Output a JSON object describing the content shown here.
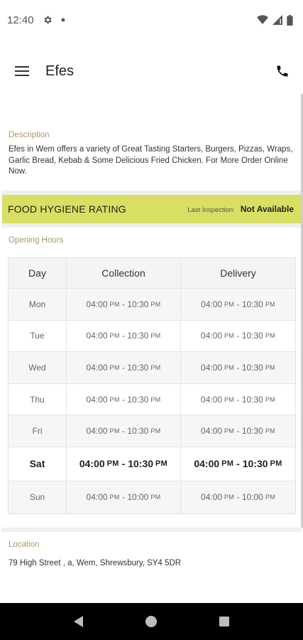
{
  "status_bar": {
    "time": "12:40",
    "icons": [
      "gear-icon",
      "dot-icon",
      "wifi-icon",
      "signal-icon",
      "battery-icon"
    ]
  },
  "app_bar": {
    "title": "Efes",
    "icons": [
      "menu-icon",
      "phone-icon"
    ]
  },
  "description": {
    "label": "Description",
    "text": "Efes in Wem offers a variety of Great Tasting Starters, Burgers, Pizzas, Wraps, Garlic Bread, Kebab & Some Delicious Fried Chicken. For More Order Online Now."
  },
  "hygiene": {
    "title": "FOOD HYGIENE RATING",
    "inspection_label": "Last Inspection:",
    "inspection_value": "Not Available",
    "color": "#d8df63"
  },
  "opening_hours": {
    "label": "Opening Hours",
    "columns": [
      "Day",
      "Collection",
      "Delivery"
    ],
    "rows": [
      {
        "day": "Mon",
        "col_start": "04:00",
        "col_start_ampm": "PM",
        "col_end": "10:30",
        "col_end_ampm": "PM",
        "del_start": "04:00",
        "del_start_ampm": "PM",
        "del_end": "10:30",
        "del_end_ampm": "PM"
      },
      {
        "day": "Tue",
        "col_start": "04:00",
        "col_start_ampm": "PM",
        "col_end": "10:30",
        "col_end_ampm": "PM",
        "del_start": "04:00",
        "del_start_ampm": "PM",
        "del_end": "10:30",
        "del_end_ampm": "PM"
      },
      {
        "day": "Wed",
        "col_start": "04:00",
        "col_start_ampm": "PM",
        "col_end": "10:30",
        "col_end_ampm": "PM",
        "del_start": "04:00",
        "del_start_ampm": "PM",
        "del_end": "10:30",
        "del_end_ampm": "PM"
      },
      {
        "day": "Thu",
        "col_start": "04:00",
        "col_start_ampm": "PM",
        "col_end": "10:30",
        "col_end_ampm": "PM",
        "del_start": "04:00",
        "del_start_ampm": "PM",
        "del_end": "10:30",
        "del_end_ampm": "PM"
      },
      {
        "day": "Fri",
        "col_start": "04:00",
        "col_start_ampm": "PM",
        "col_end": "10:30",
        "col_end_ampm": "PM",
        "del_start": "04:00",
        "del_start_ampm": "PM",
        "del_end": "10:30",
        "del_end_ampm": "PM"
      },
      {
        "day": "Sat",
        "col_start": "04:00",
        "col_start_ampm": "PM",
        "col_end": "10:30",
        "col_end_ampm": "PM",
        "del_start": "04:00",
        "del_start_ampm": "PM",
        "del_end": "10:30",
        "del_end_ampm": "PM",
        "today": true
      },
      {
        "day": "Sun",
        "col_start": "04:00",
        "col_start_ampm": "PM",
        "col_end": "10:00",
        "col_end_ampm": "PM",
        "del_start": "04:00",
        "del_start_ampm": "PM",
        "del_end": "10:00",
        "del_end_ampm": "PM"
      }
    ]
  },
  "location": {
    "label": "Location",
    "address": "79 High Street , a, Wem, Shrewsbury, SY4 5DR"
  },
  "nav_bar": {
    "icons": [
      "back-icon",
      "home-icon",
      "recents-icon"
    ]
  },
  "colors": {
    "section_label": "#a99863",
    "hygiene_bar": "#d8df63"
  }
}
